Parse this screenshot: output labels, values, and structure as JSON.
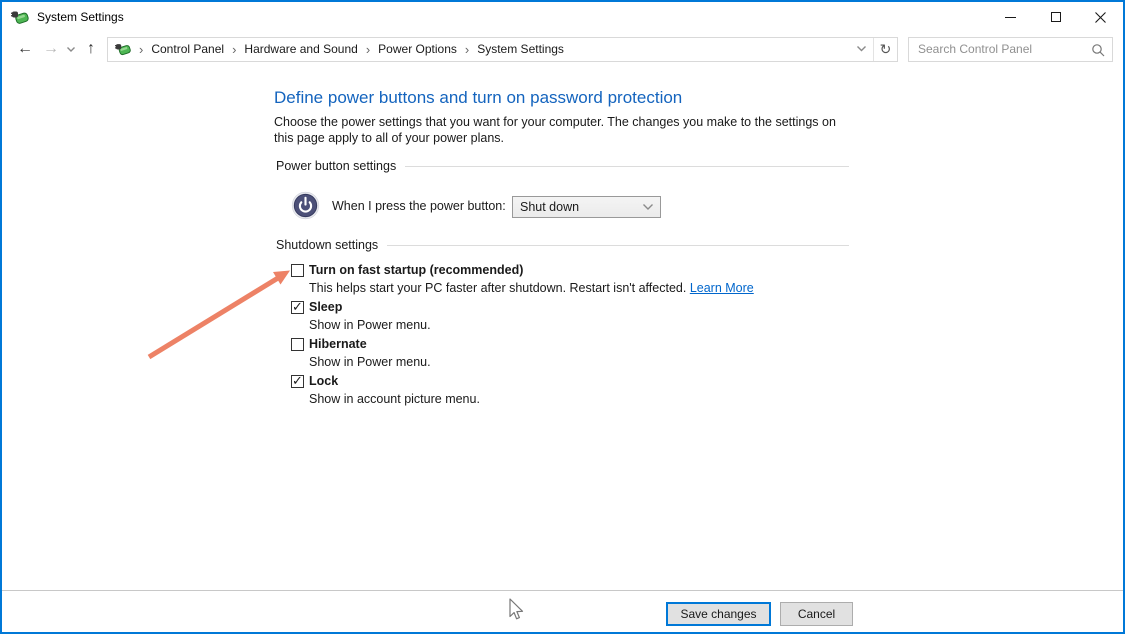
{
  "window": {
    "title": "System Settings"
  },
  "navbar": {
    "back_icon": "←",
    "forward_icon": "→",
    "up_icon": "↑",
    "refresh_icon": "↻",
    "breadcrumb": [
      "Control Panel",
      "Hardware and Sound",
      "Power Options",
      "System Settings"
    ],
    "breadcrumb_separator": "›",
    "search_placeholder": "Search Control Panel"
  },
  "main": {
    "heading": "Define power buttons and turn on password protection",
    "description": "Choose the power settings that you want for your computer. The changes you make to the settings on this page apply to all of your power plans.",
    "power_section": {
      "title": "Power button settings",
      "label": "When I press the power button:",
      "dropdown_value": "Shut down"
    },
    "shutdown_section": {
      "title": "Shutdown settings",
      "options": [
        {
          "label": "Turn on fast startup (recommended)",
          "checked": false,
          "desc": "This helps start your PC faster after shutdown. Restart isn't affected. ",
          "link": "Learn More"
        },
        {
          "label": "Sleep",
          "checked": true,
          "desc": "Show in Power menu."
        },
        {
          "label": "Hibernate",
          "checked": false,
          "desc": "Show in Power menu."
        },
        {
          "label": "Lock",
          "checked": true,
          "desc": "Show in account picture menu."
        }
      ]
    }
  },
  "footer": {
    "save_label": "Save changes",
    "cancel_label": "Cancel"
  },
  "colors": {
    "frame": "#0078d7",
    "heading": "#1464be",
    "link": "#0066cc",
    "annotation_arrow": "#ed8266"
  }
}
